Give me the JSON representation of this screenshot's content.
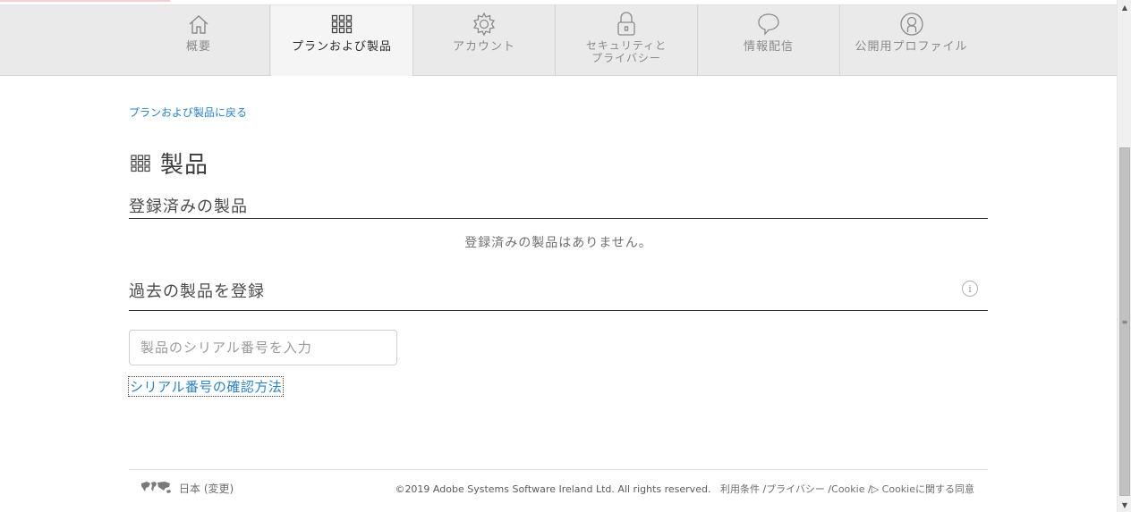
{
  "nav": {
    "items": [
      {
        "label": "概要",
        "icon": "home-icon"
      },
      {
        "label": "プランおよび製品",
        "icon": "grid-icon"
      },
      {
        "label": "アカウント",
        "icon": "gear-icon"
      },
      {
        "label_line1": "セキュリティと",
        "label_line2": "プライバシー",
        "icon": "lock-icon"
      },
      {
        "label": "情報配信",
        "icon": "chat-bubble-icon"
      },
      {
        "label": "公開用プロファイル",
        "icon": "user-profile-icon"
      }
    ],
    "active_index": 1
  },
  "main": {
    "back_link": "プランおよび製品に戻る",
    "title": "製品",
    "registered_section": {
      "title": "登録済みの製品",
      "empty_message": "登録済みの製品はありません。"
    },
    "register_section": {
      "title": "過去の製品を登録",
      "info_icon": "info-icon",
      "serial_placeholder": "製品のシリアル番号を入力",
      "serial_value": "",
      "help_link": "シリアル番号の確認方法"
    }
  },
  "footer": {
    "region": "日本 (変更)",
    "copyright": "©2019 Adobe Systems Software Ireland Ltd. All rights reserved.",
    "terms": "利用条件",
    "privacy": "プライバシー",
    "cookie": "Cookie",
    "cookie_consent": "Cookieに関する同意"
  },
  "colors": {
    "link": "#2d82c4",
    "nav_bg": "#eaeaea",
    "nav_active_bg": "#f5f5f5"
  }
}
